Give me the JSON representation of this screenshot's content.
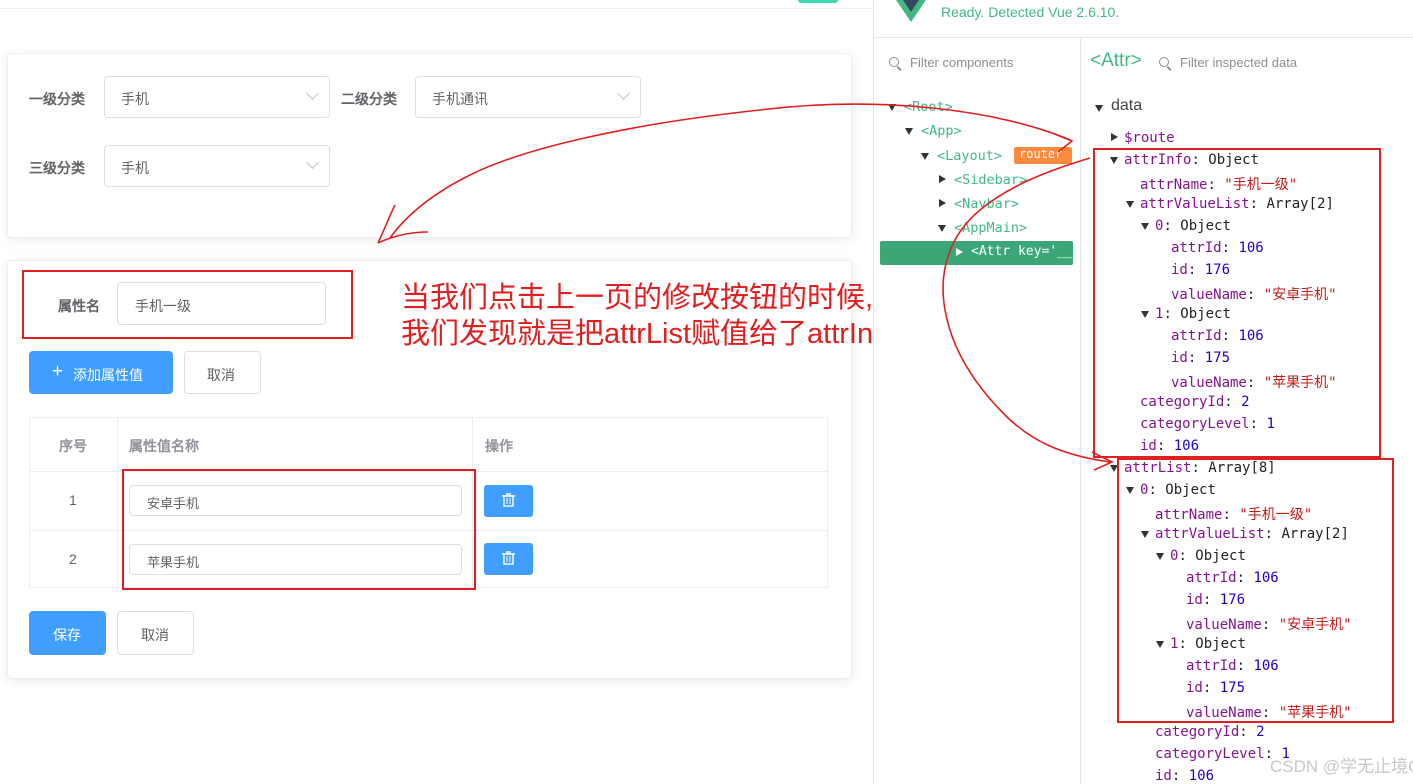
{
  "form": {
    "level1_label": "一级分类",
    "level1_value": "手机",
    "level2_label": "二级分类",
    "level2_value": "手机通讯",
    "level3_label": "三级分类",
    "level3_value": "手机"
  },
  "attr_form": {
    "attr_name_label": "属性名",
    "attr_name_value": "手机一级",
    "add_button": "添加属性值",
    "cancel_button": "取消",
    "table": {
      "headers": [
        "序号",
        "属性值名称",
        "操作"
      ],
      "rows": [
        {
          "index": "1",
          "value": "安卓手机"
        },
        {
          "index": "2",
          "value": "苹果手机"
        }
      ]
    },
    "save_button": "保存",
    "cancel_button_bottom": "取消"
  },
  "annotation": {
    "line1": "当我们点击上一页的修改按钮的时候,",
    "line2": "我们发现就是把attrList赋值给了attrInfo"
  },
  "devtools": {
    "status": "Ready. Detected Vue 2.6.10.",
    "filter_components_placeholder": "Filter components",
    "filter_data_placeholder": "Filter inspected data",
    "inspected_component": "<Attr>",
    "tree": {
      "root": "<Root>",
      "app": "<App>",
      "layout": "<Layout>",
      "router_badge": "router",
      "sidebar": "<Sidebar>",
      "navbar": "<Navbar>",
      "appmain": "<AppMain>",
      "attr": "<Attr key='__"
    },
    "section": "data",
    "lines": {
      "route": "$route",
      "ai_key": "attrInfo",
      "ai_val": "Object",
      "ai_name_key": "attrName",
      "ai_name_val": "\"手机一级\"",
      "ai_list_key": "attrValueList",
      "ai_list_val": "Array[2]",
      "ai_0": "0",
      "ai_0_val": "Object",
      "ai_0_attrId": "106",
      "ai_0_id": "176",
      "ai_0_vn": "\"安卓手机\"",
      "ai_1": "1",
      "ai_1_val": "Object",
      "ai_1_attrId": "106",
      "ai_1_id": "175",
      "ai_1_vn": "\"苹果手机\"",
      "ai_catId": "2",
      "ai_catLevel": "1",
      "ai_id": "106",
      "al_key": "attrList",
      "al_val": "Array[8]",
      "al_0": "0",
      "al_0_val": "Object",
      "al_name_val": "\"手机一级\"",
      "al_list_val": "Array[2]",
      "al_00": "0",
      "al_00_val": "Object",
      "al_00_attrId": "106",
      "al_00_id": "176",
      "al_00_vn": "\"安卓手机\"",
      "al_01": "1",
      "al_01_val": "Object",
      "al_01_attrId": "106",
      "al_01_id": "175",
      "al_01_vn": "\"苹果手机\"",
      "al_catId": "2",
      "al_catLevel": "1",
      "al_id": "106"
    },
    "labels": {
      "attrName": "attrName",
      "attrValueList": "attrValueList",
      "attrId": "attrId",
      "id": "id",
      "valueName": "valueName",
      "categoryId": "categoryId",
      "categoryLevel": "categoryLevel"
    }
  },
  "watermark": "CSDN @学无止境QAQ",
  "colors": {
    "primary": "#409eff",
    "annotation_red": "#e02020",
    "vue_green": "#42b883"
  }
}
